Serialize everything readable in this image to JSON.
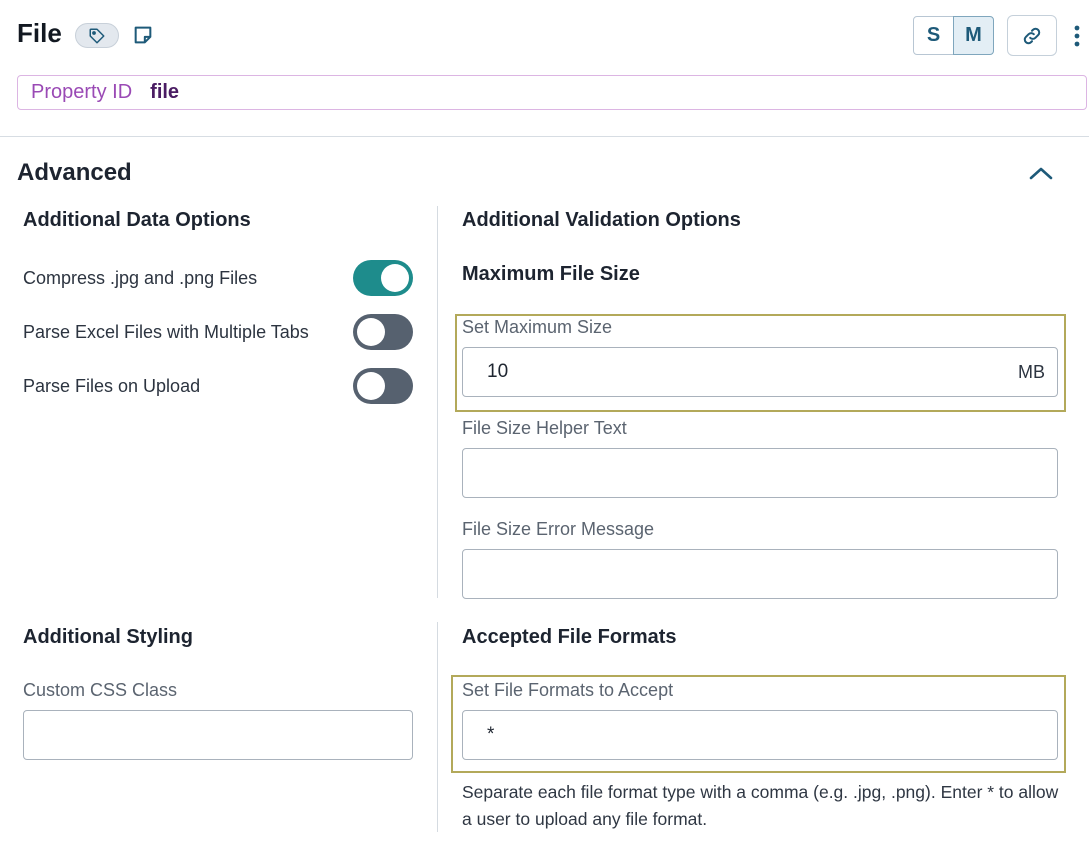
{
  "header": {
    "title": "File",
    "tag_icon": "tag-icon",
    "note_icon": "note-icon",
    "size_buttons": [
      "S",
      "M"
    ],
    "selected_size": "M",
    "link_icon": "link-icon",
    "more_icon": "kebab-icon"
  },
  "property": {
    "label": "Property ID",
    "value": "file"
  },
  "section": {
    "title": "Advanced",
    "collapse_icon": "chevron-up-icon"
  },
  "data_options": {
    "title": "Additional Data Options",
    "toggles": [
      {
        "label": "Compress .jpg and .png Files",
        "on": true
      },
      {
        "label": "Parse Excel Files with Multiple Tabs",
        "on": false
      },
      {
        "label": "Parse Files on Upload",
        "on": false
      }
    ]
  },
  "validation": {
    "title": "Additional Validation Options",
    "subtitle": "Maximum File Size",
    "max_size": {
      "label": "Set Maximum Size",
      "value": "10",
      "unit": "MB"
    },
    "helper_text": {
      "label": "File Size Helper Text",
      "value": ""
    },
    "error_message": {
      "label": "File Size Error Message",
      "value": ""
    }
  },
  "styling": {
    "title": "Additional Styling",
    "css_class": {
      "label": "Custom CSS Class",
      "value": ""
    }
  },
  "formats": {
    "title": "Accepted File Formats",
    "field": {
      "label": "Set File Formats to Accept",
      "value": "*"
    },
    "help": "Separate each file format type with a comma (e.g. .jpg, .png). Enter * to allow a user to upload any file format."
  },
  "colors": {
    "accent": "#1e8c8c",
    "property_label": "#9a4ab5",
    "highlight_border": "#b3a95a"
  }
}
